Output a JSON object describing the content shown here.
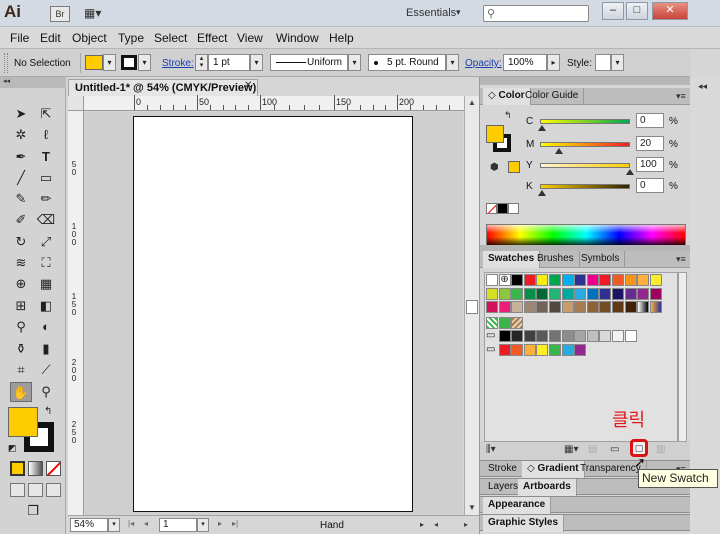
{
  "titlebar": {
    "app_logo": "Ai",
    "bridge_label": "Br",
    "workspace": "Essentials",
    "search_placeholder": ""
  },
  "menu": [
    "File",
    "Edit",
    "Object",
    "Type",
    "Select",
    "Effect",
    "View",
    "Window",
    "Help"
  ],
  "controlbar": {
    "selection": "No Selection",
    "fill_color": "#ffcc00",
    "stroke_label": "Stroke:",
    "stroke_weight": "1 pt",
    "profile": "Uniform",
    "brush": "5 pt. Round",
    "opacity_label": "Opacity:",
    "opacity": "100%",
    "style_label": "Style:"
  },
  "tools": {
    "header": "◂◂",
    "fill_color": "#ffcc00",
    "stroke_color": "#000000"
  },
  "document": {
    "tab_title": "Untitled-1* @ 54% (CMYK/Preview)",
    "hruler_labels": [
      "0",
      "50",
      "100",
      "150",
      "200"
    ],
    "vruler_labels": [
      "50",
      "100",
      "150",
      "200",
      "250"
    ],
    "zoom": "54%",
    "page": "1",
    "status": "Hand"
  },
  "color_panel": {
    "tabs": [
      "Color",
      "Color Guide"
    ],
    "sliders": [
      {
        "label": "C",
        "value": "0",
        "pct": "%"
      },
      {
        "label": "M",
        "value": "20",
        "pct": "%"
      },
      {
        "label": "Y",
        "value": "100",
        "pct": "%"
      },
      {
        "label": "K",
        "value": "0",
        "pct": "%"
      }
    ]
  },
  "swatches_panel": {
    "tabs": [
      "Swatches",
      "Brushes",
      "Symbols"
    ]
  },
  "collapsed_panels": {
    "stroke_group": [
      "Stroke",
      "Gradient",
      "Transparency"
    ],
    "layers_group": [
      "Layers",
      "Artboards"
    ],
    "appearance": "Appearance",
    "graphic_styles": "Graphic Styles"
  },
  "annotation": {
    "text": "클릭",
    "tooltip": "New Swatch"
  }
}
